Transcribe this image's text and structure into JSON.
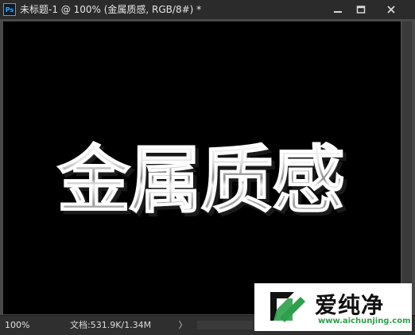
{
  "window": {
    "app_icon": "photoshop-ps-icon",
    "app_icon_text": "Ps",
    "title": "未标题-1 @ 100% (金属质感, RGB/8#) *",
    "controls": [
      "minimize-icon",
      "maximize-icon",
      "close-icon"
    ]
  },
  "canvas": {
    "background": "#000000",
    "artwork_text": "金属质感"
  },
  "statusbar": {
    "zoom": "100%",
    "doc_info": "文档:531.9K/1.34M",
    "arrow": "〉"
  },
  "watermark": {
    "brand": "爱纯净",
    "url": "www.aichunjing.com"
  }
}
